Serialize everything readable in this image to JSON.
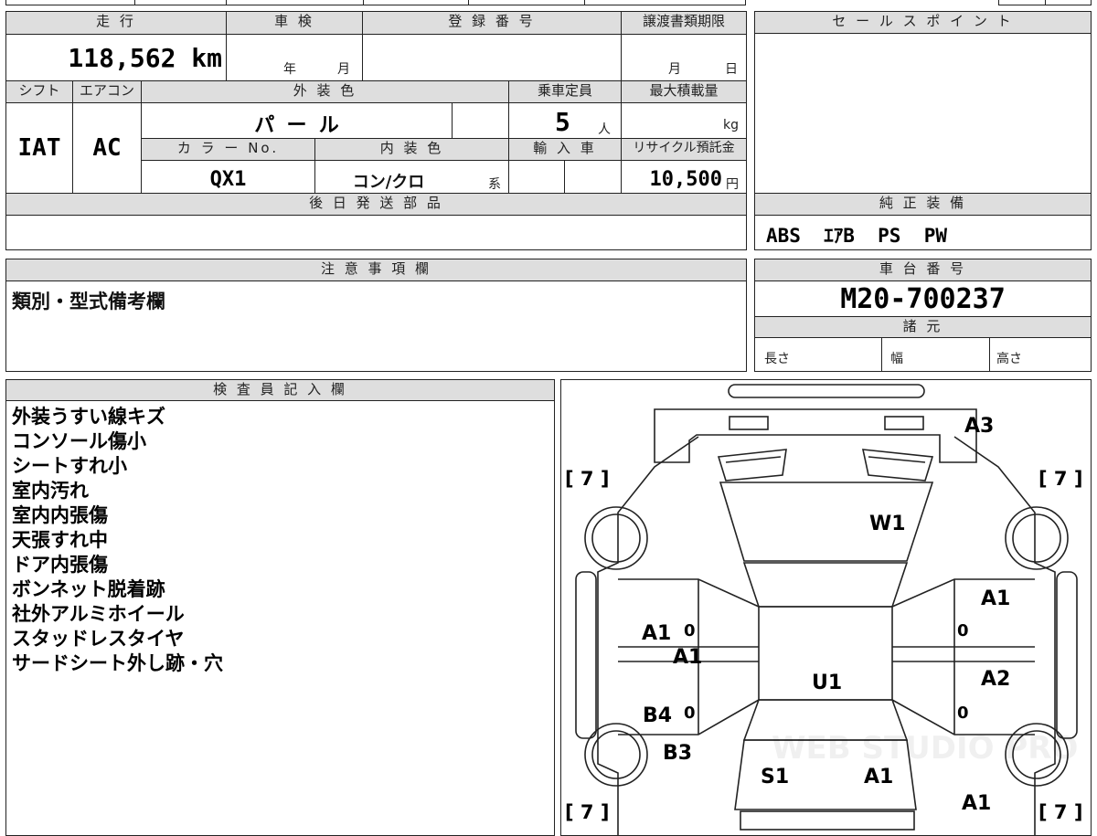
{
  "header": {
    "mileage_label": "走 行",
    "mileage_value": "118,562 km",
    "inspection_label": "車 検",
    "inspection_year": "年",
    "inspection_month": "月",
    "registration_label": "登 録 番 号",
    "transfer_label": "譲渡書類期限",
    "transfer_month": "月",
    "transfer_day": "日",
    "sales_point_label": "セ ー ル ス ポ イ ン ト"
  },
  "specs": {
    "shift_label": "シフト",
    "shift_value": "IAT",
    "ac_label": "エアコン",
    "ac_value": "AC",
    "exterior_label": "外 装 色",
    "exterior_value": "パ ー ル",
    "capacity_label": "乗車定員",
    "capacity_value": "5",
    "capacity_unit": "人",
    "max_load_label": "最大積載量",
    "max_load_unit": "kg",
    "color_no_label": "カ ラ ー No.",
    "color_no_value": "QX1",
    "interior_label": "内 装 色",
    "interior_value": "コン/クロ",
    "interior_suffix": "系",
    "import_label": "輸 入 車",
    "recycle_label": "リサイクル預託金",
    "recycle_value": "10,500",
    "recycle_unit": "円"
  },
  "later_parts": {
    "label": "後 日 発 送 部 品"
  },
  "equipment": {
    "label": "純 正 装 備",
    "value": "ABS  ｴｱB  PS  PW"
  },
  "notes": {
    "label": "注 意 事 項 欄",
    "value": "類別・型式備考欄"
  },
  "chassis": {
    "label": "車 台 番 号",
    "value": "M20-700237",
    "spec_label": "諸 元",
    "length_label": "長さ",
    "width_label": "幅",
    "height_label": "高さ"
  },
  "inspector": {
    "label": "検 査 員 記 入 欄",
    "lines": [
      "外装うすい線キズ",
      "コンソール傷小",
      "シートすれ小",
      "室内汚れ",
      "室内内張傷",
      "天張すれ中",
      "ドア内張傷",
      "ボンネット脱着跡",
      "社外アルミホイール",
      "スタッドレスタイヤ",
      "サードシート外し跡・穴"
    ]
  },
  "diagram": {
    "tire_front_left": "[ 7 ]",
    "tire_front_right": "[ 7 ]",
    "tire_rear_left": "[ 7 ]",
    "tire_rear_right": "[ 7 ]",
    "marks": [
      "A3",
      "W1",
      "A1",
      "A1",
      "A1",
      "A2",
      "U1",
      "B4",
      "B3",
      "S1",
      "A1",
      "A1"
    ],
    "door_marks": [
      "0",
      "0",
      "0",
      "0"
    ],
    "watermark": "WEB STUDIO PRO"
  }
}
